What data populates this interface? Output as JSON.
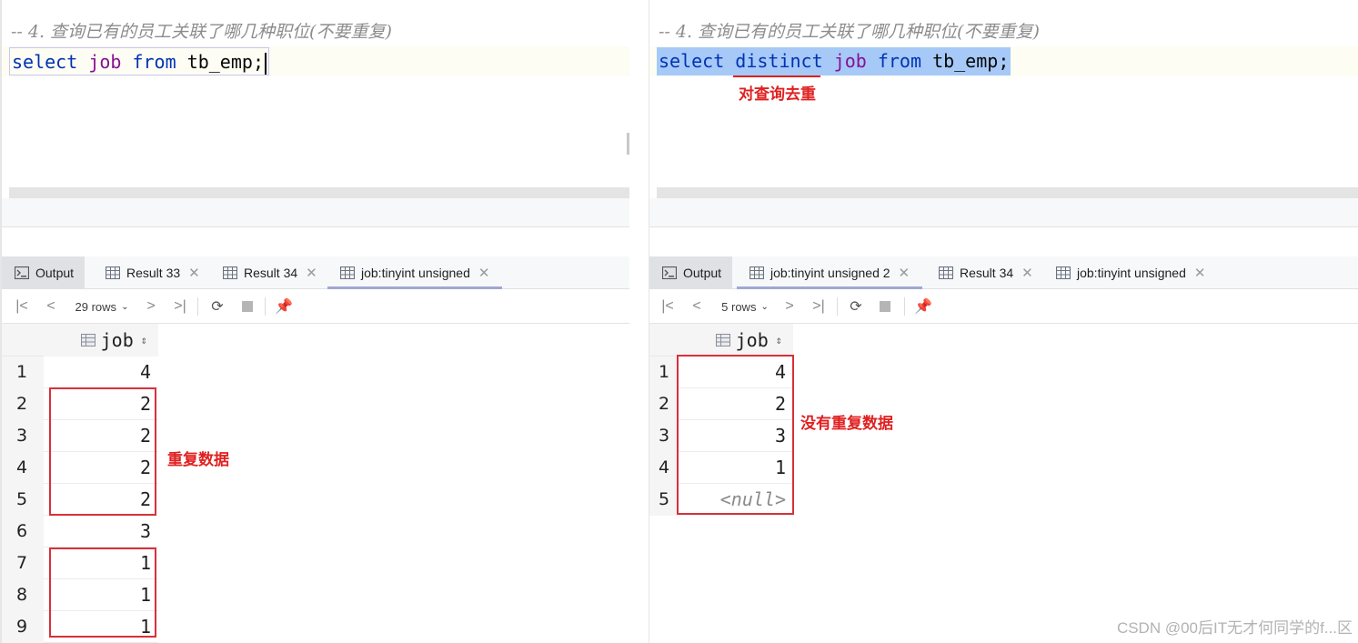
{
  "left": {
    "editor": {
      "comment": "-- 4. 查询已有的员工关联了哪几种职位(不要重复)",
      "code": {
        "kw1": "select",
        "col": "job",
        "kw2": "from",
        "table": "tb_emp",
        "end": ";"
      }
    },
    "tabs": [
      {
        "label": "Output",
        "icon": "output-icon"
      },
      {
        "label": "Result 33",
        "icon": "table-icon"
      },
      {
        "label": "Result 34",
        "icon": "table-icon"
      },
      {
        "label": "job:tinyint unsigned",
        "icon": "table-icon"
      }
    ],
    "toolbar": {
      "rows_label": "29 rows"
    },
    "grid": {
      "column": "job",
      "rows": [
        {
          "n": "1",
          "v": "4"
        },
        {
          "n": "2",
          "v": "2"
        },
        {
          "n": "3",
          "v": "2"
        },
        {
          "n": "4",
          "v": "2"
        },
        {
          "n": "5",
          "v": "2"
        },
        {
          "n": "6",
          "v": "3"
        },
        {
          "n": "7",
          "v": "1"
        },
        {
          "n": "8",
          "v": "1"
        },
        {
          "n": "9",
          "v": "1"
        }
      ]
    },
    "annotation": "重复数据"
  },
  "right": {
    "editor": {
      "comment": "-- 4. 查询已有的员工关联了哪几种职位(不要重复)",
      "code": {
        "kw1": "select",
        "kw_distinct": "distinct",
        "col": "job",
        "kw2": "from",
        "table": "tb_emp",
        "end": ";"
      }
    },
    "annotation_dedupe": "对查询去重",
    "tabs": [
      {
        "label": "Output",
        "icon": "output-icon"
      },
      {
        "label": "job:tinyint unsigned 2",
        "icon": "table-icon"
      },
      {
        "label": "Result 34",
        "icon": "table-icon"
      },
      {
        "label": "job:tinyint unsigned",
        "icon": "table-icon"
      }
    ],
    "toolbar": {
      "rows_label": "5 rows"
    },
    "grid": {
      "column": "job",
      "rows": [
        {
          "n": "1",
          "v": "4"
        },
        {
          "n": "2",
          "v": "2"
        },
        {
          "n": "3",
          "v": "3"
        },
        {
          "n": "4",
          "v": "1"
        },
        {
          "n": "5",
          "v": "<null>"
        }
      ]
    },
    "annotation": "没有重复数据"
  },
  "watermark": "CSDN @00后IT无才何同学的f...区",
  "colors": {
    "annotation": "#e02020",
    "keyword": "#0033b3",
    "column": "#871094",
    "selection": "#a6c9f7"
  }
}
